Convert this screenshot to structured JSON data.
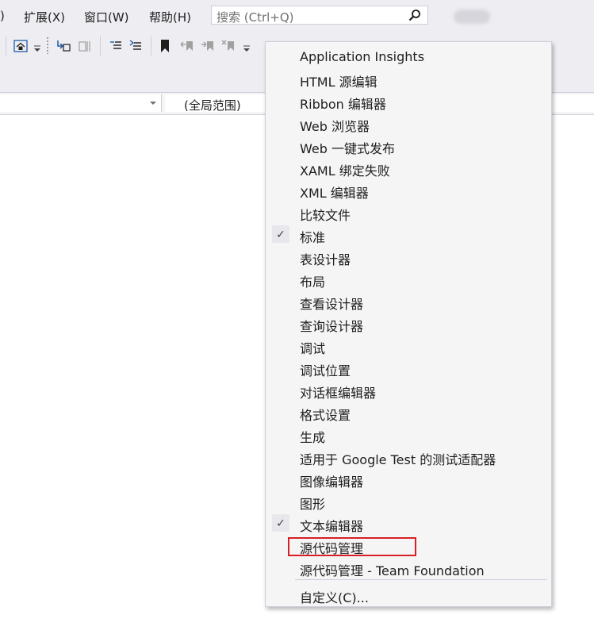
{
  "menubar": {
    "items": [
      {
        "label": ")"
      },
      {
        "label": "扩展(X)"
      },
      {
        "label": "窗口(W)"
      },
      {
        "label": "帮助(H)"
      }
    ],
    "search_placeholder": "搜索 (Ctrl+Q)"
  },
  "toolbar": {
    "icons": [
      "home-icon",
      "dropdown-arrow-icon",
      "indent-icon",
      "outdent-icon",
      "comment-icon",
      "uncomment-icon",
      "bookmark-icon",
      "prev-bookmark-icon",
      "next-bookmark-icon",
      "clear-bookmarks-icon",
      "overflow-icon"
    ]
  },
  "navbar": {
    "scope_label": "(全局范围)"
  },
  "context_menu": {
    "items": [
      {
        "label": "Application Insights",
        "checked": false
      },
      {
        "label": "HTML 源编辑",
        "checked": false
      },
      {
        "label": "Ribbon 编辑器",
        "checked": false
      },
      {
        "label": "Web 浏览器",
        "checked": false
      },
      {
        "label": "Web 一键式发布",
        "checked": false
      },
      {
        "label": "XAML 绑定失败",
        "checked": false
      },
      {
        "label": "XML 编辑器",
        "checked": false
      },
      {
        "label": "比较文件",
        "checked": false
      },
      {
        "label": "标准",
        "checked": true
      },
      {
        "label": "表设计器",
        "checked": false
      },
      {
        "label": "布局",
        "checked": false
      },
      {
        "label": "查看设计器",
        "checked": false
      },
      {
        "label": "查询设计器",
        "checked": false
      },
      {
        "label": "调试",
        "checked": false
      },
      {
        "label": "调试位置",
        "checked": false
      },
      {
        "label": "对话框编辑器",
        "checked": false
      },
      {
        "label": "格式设置",
        "checked": false
      },
      {
        "label": "生成",
        "checked": false
      },
      {
        "label": "适用于 Google Test 的测试适配器",
        "checked": false
      },
      {
        "label": "图像编辑器",
        "checked": false
      },
      {
        "label": "图形",
        "checked": false
      },
      {
        "label": "文本编辑器",
        "checked": true
      },
      {
        "label": "源代码管理",
        "checked": false,
        "highlighted": true
      },
      {
        "label": "源代码管理 - Team Foundation",
        "checked": false
      }
    ],
    "customize_label": "自定义(C)...",
    "check_glyph": "✓",
    "highlight_color": "#d81f26"
  }
}
